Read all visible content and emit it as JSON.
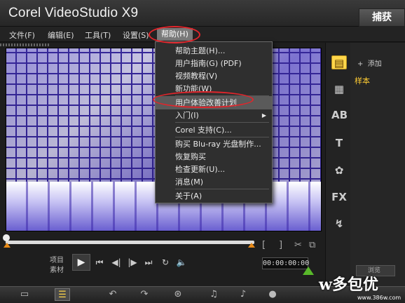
{
  "window": {
    "title": "Corel VideoStudio X9",
    "capture_tab": "捕获"
  },
  "menubar": {
    "items": [
      "文件(F)",
      "编辑(E)",
      "工具(T)",
      "设置(S)",
      "帮助(H)"
    ],
    "active": "帮助(H)"
  },
  "help_menu": {
    "items": [
      {
        "label": "帮助主题(H)...",
        "submenu": false
      },
      {
        "label": "用户指南(G) (PDF)",
        "submenu": false
      },
      {
        "label": "视频教程(V)",
        "submenu": false
      },
      {
        "label": "新功能(W)",
        "submenu": false
      },
      {
        "label": "用户体验改善计划",
        "submenu": false,
        "highlighted": true
      },
      {
        "label": "入门(I)",
        "submenu": true
      },
      {
        "label": "Corel 支持(C)...",
        "submenu": false
      },
      {
        "label": "购买 Blu-ray 光盘制作...",
        "submenu": false
      },
      {
        "label": "恢复购买",
        "submenu": false
      },
      {
        "label": "检查更新(U)...",
        "submenu": false
      },
      {
        "label": "消息(M)",
        "submenu": false
      },
      {
        "label": "关于(A)",
        "submenu": false
      }
    ]
  },
  "preview": {
    "mode_project": "项目",
    "mode_clip": "素材",
    "timecode": "00:00:00:00",
    "trim_in": "[",
    "trim_out": "]"
  },
  "library": {
    "add_label": "添加",
    "sample_label": "样本",
    "bottom_button": "浏览"
  },
  "watermark": {
    "text": "w多包优",
    "url": "www.386w.com"
  },
  "colors": {
    "accent": "#ffd64a",
    "annotation": "#e1252b",
    "marker": "#e78a18"
  }
}
